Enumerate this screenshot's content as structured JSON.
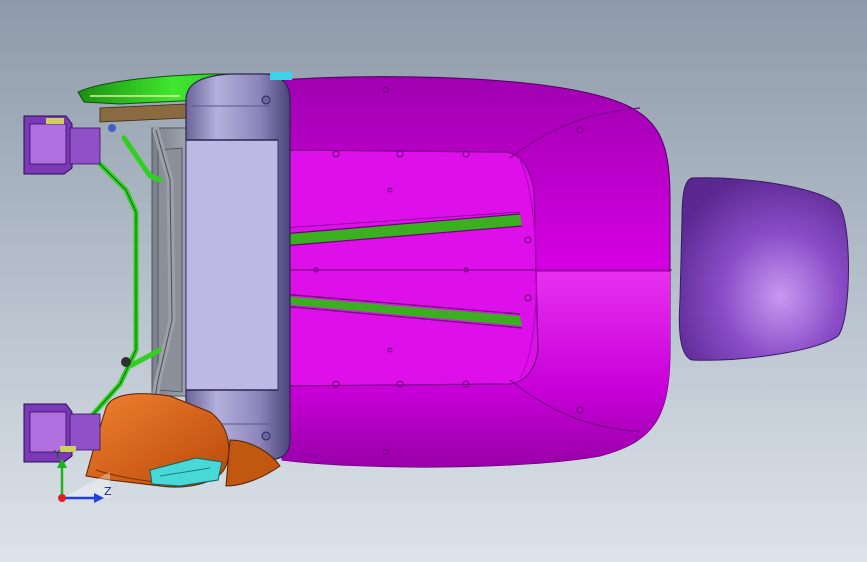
{
  "viewport": {
    "background_top": "#8e9aa9",
    "background_bottom": "#dde3ea"
  },
  "model": {
    "cushion_color": "#d400e0",
    "headrest_color": "#7a3bb8",
    "backrest_frame_color": "#9a96c8",
    "mechanism_color": "#30e020",
    "side_cover_color": "#e06818",
    "bracket_color": "#8a3ec4",
    "clip_color": "#40d8d8"
  },
  "triad": {
    "y_label": "Y",
    "z_label": "Z",
    "y_color": "#20b020",
    "z_color": "#2040e0",
    "origin_color": "#e02020"
  }
}
